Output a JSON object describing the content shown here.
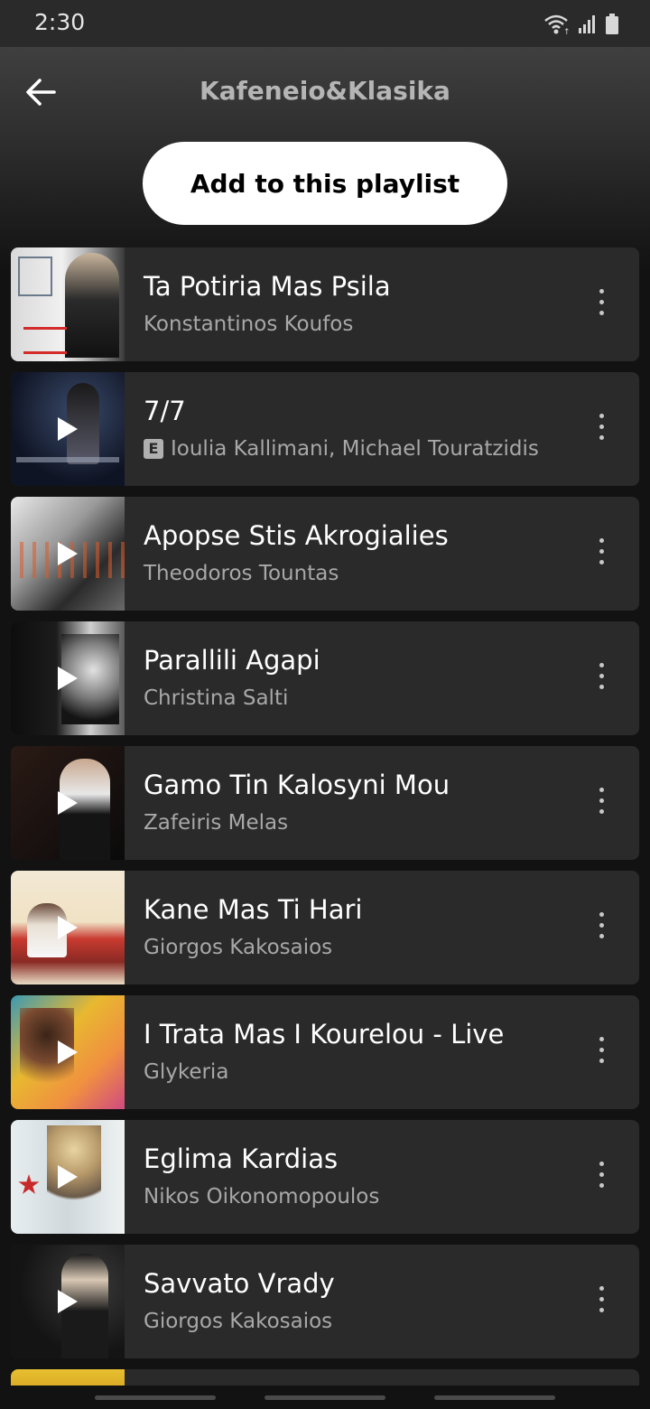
{
  "status_bar": {
    "time": "2:30",
    "icons": [
      "wifi-icon",
      "signal-icon",
      "battery-icon"
    ]
  },
  "header": {
    "title": "Kafeneio&Klasika",
    "back_icon": "arrow-left-icon"
  },
  "add_button_label": "Add to this playlist",
  "explicit_badge": "E",
  "songs": [
    {
      "title": "Ta Potiria Mas Psila",
      "artist": "Konstantinos Koufos"
    },
    {
      "title": "7/7",
      "artist": "Ioulia Kallimani, Michael Touratzidis",
      "explicit": true
    },
    {
      "title": "Apopse Stis Akrogialies",
      "artist": "Theodoros Tountas"
    },
    {
      "title": "Parallili Agapi",
      "artist": "Christina Salti"
    },
    {
      "title": "Gamo Tin Kalosyni Mou",
      "artist": "Zafeiris Melas"
    },
    {
      "title": "Kane Mas Ti Hari",
      "artist": "Giorgos Kakosaios"
    },
    {
      "title": "I Trata Mas I Kourelou - Live",
      "artist": "Glykeria"
    },
    {
      "title": "Eglima Kardias",
      "artist": "Nikos Oikonomopoulos"
    },
    {
      "title": "Savvato Vrady",
      "artist": "Giorgos Kakosaios"
    }
  ],
  "colors": {
    "background": "#121212",
    "card": "#2a2a2a",
    "primary_text": "#ffffff",
    "secondary_text": "#a8a8a8",
    "button_bg": "#ffffff"
  }
}
